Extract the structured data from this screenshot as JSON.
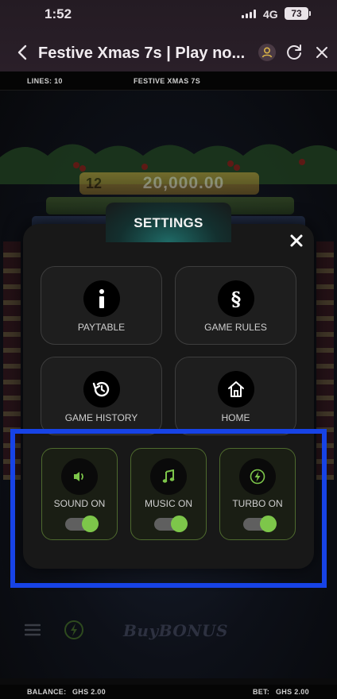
{
  "status_bar": {
    "time": "1:52",
    "network": "4G",
    "battery": "73"
  },
  "browser": {
    "title": "Festive Xmas 7s | Play no..."
  },
  "game_strip": {
    "lines": "LINES: 10",
    "game_name": "FESTIVE XMAS 7S"
  },
  "jackpot": {
    "level": "12",
    "value": "20,000.00"
  },
  "settings": {
    "title": "SETTINGS",
    "tiles": [
      {
        "label": "PAYTABLE",
        "icon": "info-icon"
      },
      {
        "label": "GAME RULES",
        "icon": "section-icon"
      },
      {
        "label": "GAME HISTORY",
        "icon": "history-icon"
      },
      {
        "label": "HOME",
        "icon": "home-icon"
      }
    ],
    "toggles": [
      {
        "label": "SOUND ON",
        "icon": "speaker-icon",
        "on": true
      },
      {
        "label": "MUSIC ON",
        "icon": "music-note-icon",
        "on": true
      },
      {
        "label": "TURBO ON",
        "icon": "lightning-icon",
        "on": true
      }
    ]
  },
  "bottom_bar": {
    "buy_bonus": "BuyBONUS"
  },
  "footer": {
    "balance_label": "BALANCE:",
    "balance_value": "GHS 2.00",
    "bet_label": "BET:",
    "bet_value": "GHS 2.00"
  },
  "colors": {
    "accent_green": "#7dc64a",
    "highlight_blue": "#1743e6",
    "modal_bg": "#181818"
  }
}
